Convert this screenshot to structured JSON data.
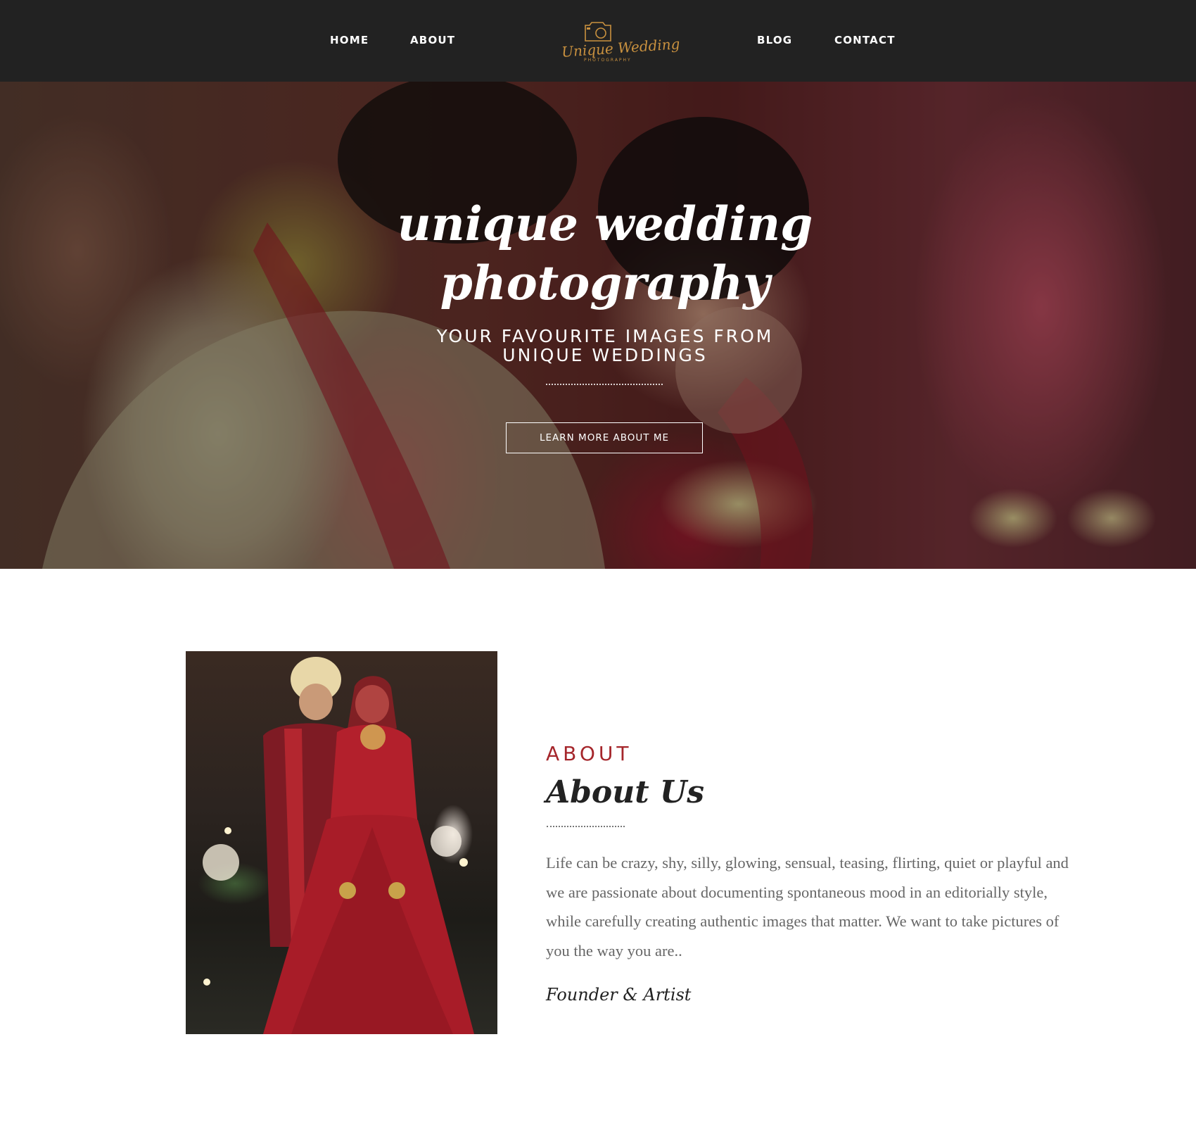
{
  "header": {
    "nav_left": [
      {
        "label": "HOME"
      },
      {
        "label": "ABOUT"
      }
    ],
    "nav_right": [
      {
        "label": "BLOG"
      },
      {
        "label": "CONTACT"
      }
    ],
    "logo": {
      "text": "Unique Wedding",
      "subtext": "PHOTOGRAPHY",
      "icon": "camera-icon",
      "color": "#c9913f"
    }
  },
  "hero": {
    "title": "unique wedding photography",
    "subtitle": "YOUR FAVOURITE IMAGES FROM UNIQUE WEDDINGS",
    "button_label": "LEARN MORE ABOUT ME"
  },
  "about": {
    "eyebrow": "ABOUT",
    "title": "About Us",
    "body": "Life can be crazy, shy, silly, glowing, sensual, teasing, flirting, quiet or playful and we are passionate about documenting spontaneous mood in an editorially style, while carefully creating authentic images that matter. We want to take pictures of you the way you are..",
    "signature": "Founder & Artist",
    "accent_color": "#a5262b"
  },
  "colors": {
    "header_bg": "#222222",
    "text_dark": "#222222",
    "text_body": "#666666"
  }
}
